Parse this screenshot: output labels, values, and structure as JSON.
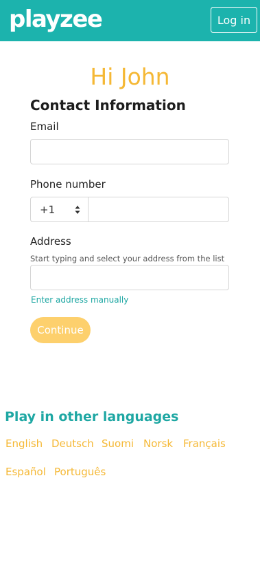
{
  "header": {
    "logo_text": "playzee",
    "login_label": "Log in",
    "bar_color": "#1cb3ad"
  },
  "greeting": "Hi John",
  "form": {
    "section_title": "Contact Information",
    "email": {
      "label": "Email",
      "value": "",
      "placeholder": ""
    },
    "phone": {
      "label": "Phone number",
      "country_code": "+1",
      "value": "",
      "placeholder": ""
    },
    "address": {
      "label": "Address",
      "hint": "Start typing and select your address from the list",
      "value": "",
      "placeholder": "",
      "manual_link": "Enter address manually"
    },
    "continue_label": "Continue"
  },
  "languages": {
    "title": "Play in other languages",
    "items": [
      "English",
      "Deutsch",
      "Suomi",
      "Norsk",
      "Français",
      "Español",
      "Português"
    ]
  },
  "colors": {
    "accent_teal": "#1cb3ad",
    "accent_yellow": "#f5b835",
    "button_yellow": "#fdd06d"
  }
}
